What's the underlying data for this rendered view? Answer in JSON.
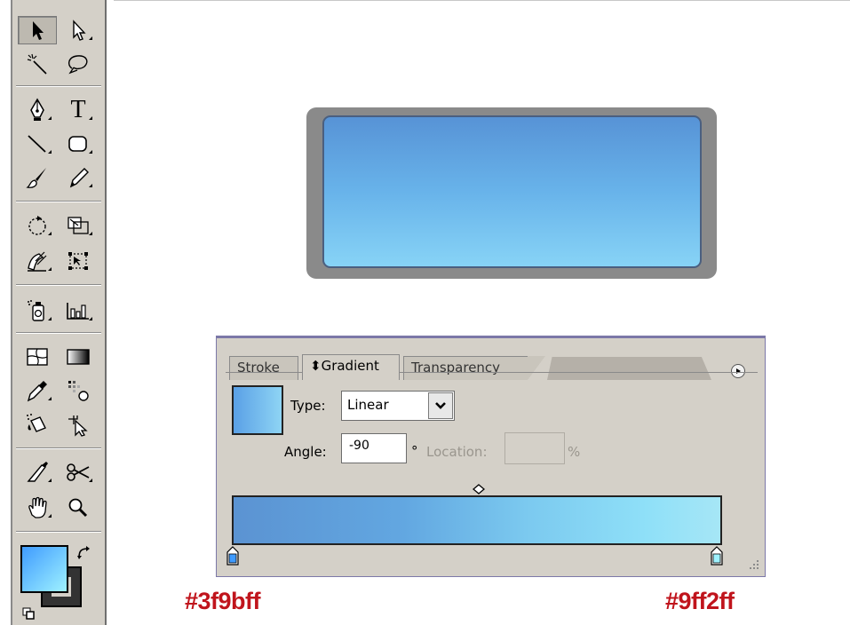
{
  "tool_palette": {
    "tools": [
      {
        "name": "selection-tool",
        "icon": "arrow-black-icon",
        "selected": true
      },
      {
        "name": "direct-selection-tool",
        "icon": "arrow-white-icon"
      },
      {
        "name": "magic-wand-tool",
        "icon": "magic-wand-icon"
      },
      {
        "name": "lasso-tool",
        "icon": "lasso-icon"
      },
      {
        "name": "pen-tool",
        "icon": "pen-nib-icon"
      },
      {
        "name": "type-tool",
        "icon": "type-t-icon",
        "glyph": "T"
      },
      {
        "name": "line-tool",
        "icon": "line-segment-icon"
      },
      {
        "name": "rounded-rectangle-tool",
        "icon": "rounded-rectangle-icon"
      },
      {
        "name": "paintbrush-tool",
        "icon": "paintbrush-icon"
      },
      {
        "name": "pencil-tool",
        "icon": "pencil-icon"
      },
      {
        "name": "rotate-tool",
        "icon": "rotate-icon"
      },
      {
        "name": "scale-tool",
        "icon": "scale-icon"
      },
      {
        "name": "warp-tool",
        "icon": "warp-icon"
      },
      {
        "name": "free-transform-tool",
        "icon": "free-transform-icon"
      },
      {
        "name": "symbol-sprayer-tool",
        "icon": "symbol-sprayer-icon"
      },
      {
        "name": "graph-tool",
        "icon": "column-graph-icon"
      },
      {
        "name": "mesh-tool",
        "icon": "mesh-icon"
      },
      {
        "name": "gradient-tool",
        "icon": "gradient-icon"
      },
      {
        "name": "eyedropper-tool",
        "icon": "eyedropper-icon"
      },
      {
        "name": "blend-tool",
        "icon": "blend-icon"
      },
      {
        "name": "live-paint-bucket-tool",
        "icon": "paint-bucket-icon"
      },
      {
        "name": "live-paint-selection-tool",
        "icon": "live-paint-selection-icon"
      },
      {
        "name": "slice-tool",
        "icon": "slice-knife-icon"
      },
      {
        "name": "scissors-tool",
        "icon": "scissors-icon"
      },
      {
        "name": "hand-tool",
        "icon": "hand-icon"
      },
      {
        "name": "zoom-tool",
        "icon": "zoom-magnifier-icon"
      }
    ],
    "fill_color": "#3f9bff",
    "fill_gradient_end": "#9ff2ff",
    "stroke_color": "#333333"
  },
  "gradient_panel": {
    "tabs": [
      {
        "label": "Stroke",
        "active": false
      },
      {
        "label": "⬍Gradient",
        "active": true
      },
      {
        "label": "Transparency",
        "active": false
      }
    ],
    "type_label": "Type:",
    "type_value": "Linear",
    "angle_label": "Angle:",
    "angle_value": "-90",
    "degree_symbol": "°",
    "location_label": "Location:",
    "location_value": "",
    "percent_label": "%",
    "stops": [
      {
        "color": "#3f9bff",
        "location": 0
      },
      {
        "color": "#9ff2ff",
        "location": 100
      }
    ],
    "midpoint": 50
  },
  "annotations": {
    "left_color": "#3f9bff",
    "right_color": "#9ff2ff"
  }
}
